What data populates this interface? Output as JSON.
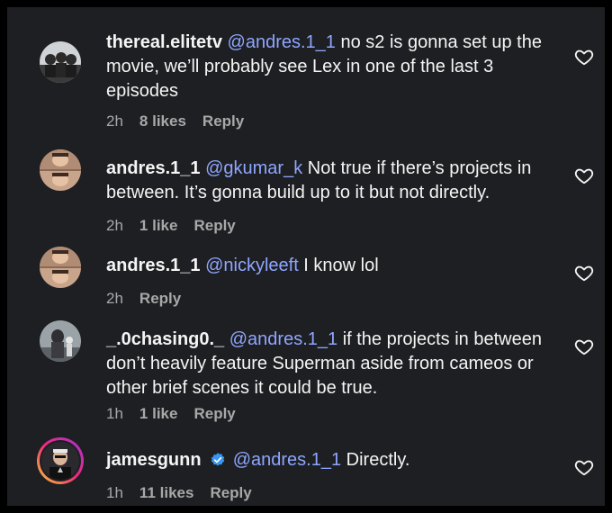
{
  "comments": [
    {
      "username": "thereal.elitetv",
      "mention": "@andres.1_1",
      "text": " no s2 is gonna set up the movie, we’ll probably see Lex in one of the last 3 episodes",
      "time": "2h",
      "likes": "8 likes",
      "reply": "Reply"
    },
    {
      "username": "andres.1_1",
      "mention": "@gkumar_k",
      "text": " Not true if there’s projects in between. It’s gonna build up to it but not directly.",
      "time": "2h",
      "likes": "1 like",
      "reply": "Reply"
    },
    {
      "username": "andres.1_1",
      "mention": "@nickyleeft",
      "text": " I know lol",
      "time": "2h",
      "likes": "",
      "reply": "Reply"
    },
    {
      "username": "_.0chasing0._",
      "mention": "@andres.1_1",
      "text": " if the projects in between don’t heavily feature Superman aside from cameos or other brief scenes it could be true.",
      "time": "1h",
      "likes": "1 like",
      "reply": "Reply"
    },
    {
      "username": "jamesgunn",
      "mention": "@andres.1_1",
      "text": " Directly.",
      "time": "1h",
      "likes": "11 likes",
      "reply": "Reply"
    }
  ],
  "colors": {
    "background": "#1e1f22",
    "mention": "#8ea6ff",
    "meta": "#a8a8a8",
    "verified": "#3897f0"
  },
  "icons": {
    "like": "heart-outline-icon",
    "verified": "verified-badge-icon"
  }
}
